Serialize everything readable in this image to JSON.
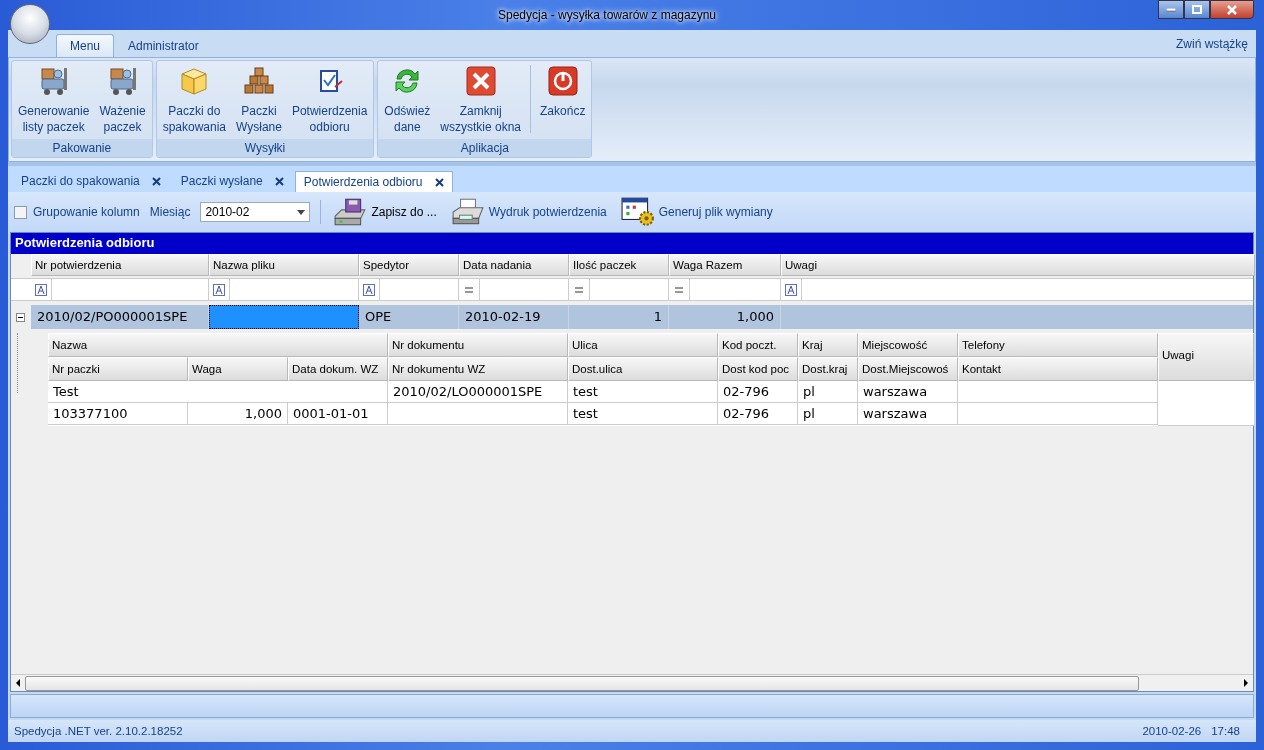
{
  "window": {
    "title": "Spedycja - wysyłka towarów z magazynu"
  },
  "ribbon": {
    "tabs": [
      {
        "label": "Menu",
        "selected": true
      },
      {
        "label": "Administrator",
        "selected": false
      }
    ],
    "collapse_link": "Zwiń wstążkę",
    "groups": [
      {
        "label": "Pakowanie",
        "buttons": [
          {
            "label": "Generowanie\nlisty paczek"
          },
          {
            "label": "Ważenie\npaczek"
          }
        ]
      },
      {
        "label": "Wysyłki",
        "buttons": [
          {
            "label": "Paczki do\nspakowania"
          },
          {
            "label": "Paczki\nWysłane"
          },
          {
            "label": "Potwierdzenia\nodbioru"
          }
        ]
      },
      {
        "label": "Aplikacja",
        "buttons": [
          {
            "label": "Odśwież\ndane"
          },
          {
            "label": "Zamknij\nwszystkie okna"
          },
          {
            "label": "Zakończ"
          }
        ]
      }
    ]
  },
  "doc_tabs": [
    {
      "label": "Paczki do spakowania",
      "selected": false
    },
    {
      "label": "Paczki wysłane",
      "selected": false
    },
    {
      "label": "Potwierdzenia odbioru",
      "selected": true
    }
  ],
  "toolbar": {
    "grouping": {
      "label": "Grupowanie kolumn",
      "checked": false
    },
    "month": {
      "label": "Miesiąc",
      "value": "2010-02"
    },
    "actions": [
      {
        "label": "Zapisz do ..."
      },
      {
        "label": "Wydruk potwierdzenia"
      },
      {
        "label": "Generuj plik wymiany"
      }
    ]
  },
  "grid": {
    "title": "Potwierdzenia odbioru",
    "columns": [
      {
        "label": "Nr potwierdzenia",
        "kind": "text"
      },
      {
        "label": "Nazwa pliku",
        "kind": "text"
      },
      {
        "label": "Spedytor",
        "kind": "text"
      },
      {
        "label": "Data nadania",
        "kind": "equals"
      },
      {
        "label": "Ilość paczek",
        "kind": "equals"
      },
      {
        "label": "Waga Razem",
        "kind": "equals"
      },
      {
        "label": "Uwagi",
        "kind": "text"
      }
    ],
    "rows": [
      {
        "expanded": true,
        "cells": [
          {
            "text": "2010/02/PO000001SPE",
            "focused": false
          },
          {
            "focused": true
          },
          {
            "text": "OPE",
            "focused": false
          },
          {
            "text": "2010-02-19",
            "focused": false
          },
          {
            "text": "1",
            "focused": false
          },
          {
            "text": "1,000",
            "focused": false
          },
          {
            "focused": false
          }
        ],
        "detail": {
          "bands": [
            {
              "label": "Nazwa",
              "value": "Test"
            },
            {
              "label": "Nr dokumentu",
              "value": "2010/02/LO000001SPE"
            },
            {
              "label": "Ulica",
              "value": "test"
            },
            {
              "label": "Kod poczt.",
              "value": "02-796"
            },
            {
              "label": "Kraj",
              "value": "pl"
            },
            {
              "label": "Miejscowość",
              "value": "warszawa"
            },
            {
              "label": "Telefony"
            }
          ],
          "columns": [
            {
              "label": "Nr paczki",
              "value": "103377100"
            },
            {
              "label": "Waga",
              "value": "1,000"
            },
            {
              "label": "Data dokum. WZ",
              "value": "0001-01-01"
            },
            {
              "label": "Nr dokumentu WZ"
            },
            {
              "label": "Dost.ulica",
              "value": "test"
            },
            {
              "label": "Dost kod poc",
              "value": "02-796"
            },
            {
              "label": "Dost.kraj",
              "value": "pl"
            },
            {
              "label": "Dost.Miejscowoś",
              "value": "warszawa"
            },
            {
              "label": "Kontakt"
            }
          ],
          "side_column": "Uwagi"
        }
      }
    ]
  },
  "status_bar": {
    "version": "Spedycja .NET ver. 2.10.2.18252",
    "date": "2010-02-26",
    "time": "17:48"
  }
}
